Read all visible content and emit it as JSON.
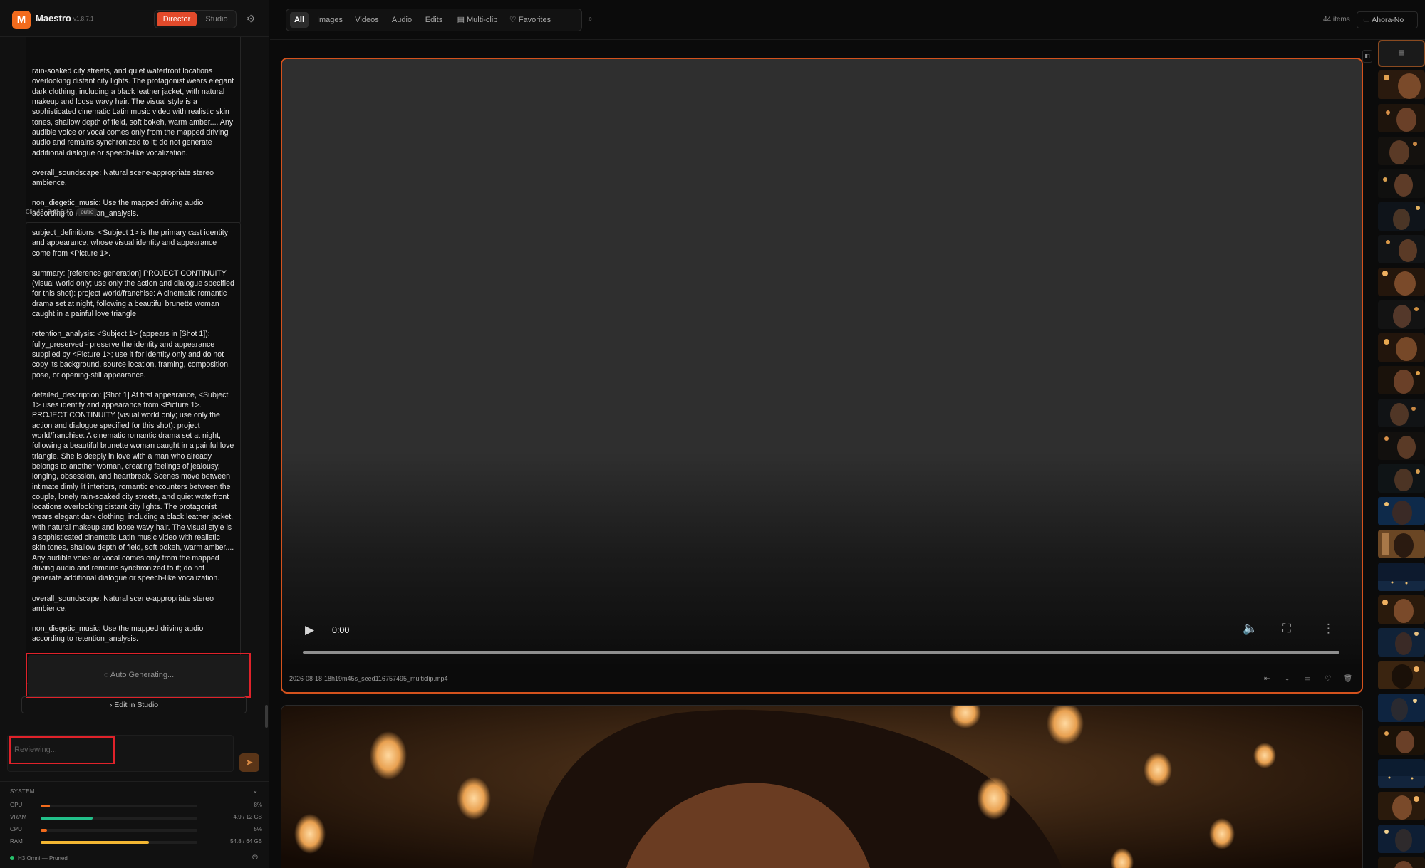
{
  "app": {
    "logo_letter": "M",
    "name": "Maestro",
    "version": "v1.8.7.1",
    "modes": {
      "director": "Director",
      "studio": "Studio"
    },
    "active_mode": "Director"
  },
  "clips": {
    "previous_tail": [
      "rain-soaked city streets, and quiet waterfront locations overlooking distant city lights. The protagonist wears elegant dark clothing, including a black leather jacket, with natural makeup and loose wavy hair. The visual style is a sophisticated cinematic Latin music video with realistic skin tones, shallow depth of field, soft bokeh, warm amber.... Any audible voice or vocal comes only from the mapped driving audio and remains synchronized to it; do not generate additional dialogue or speech-like vocalization.",
      "overall_soundscape: Natural scene-appropriate stereo ambience.",
      "non_diegetic_music: Use the mapped driving audio according to retention_analysis."
    ],
    "clip_43": {
      "label": "Clip 43",
      "time": "3:41-3:47",
      "tag": "outro",
      "paragraphs": [
        "subject_definitions: <Subject 1> is the primary cast identity and appearance, whose visual identity and appearance come from <Picture 1>.",
        "summary: [reference generation] PROJECT CONTINUITY (visual world only; use only the action and dialogue specified for this shot): project world/franchise: A cinematic romantic drama set at night, following a beautiful brunette woman caught in a painful love triangle",
        "retention_analysis: <Subject 1> (appears in [Shot 1]): fully_preserved - preserve the identity and appearance supplied by <Picture 1>; use it for identity only and do not copy its background, source location, framing, composition, pose, or opening-still appearance.",
        "detailed_description: [Shot 1] At first appearance, <Subject 1> uses identity and appearance from <Picture 1>. PROJECT CONTINUITY (visual world only; use only the action and dialogue specified for this shot): project world/franchise: A cinematic romantic drama set at night, following a beautiful brunette woman caught in a painful love triangle. She is deeply in love with a man who already belongs to another woman, creating feelings of jealousy, longing, obsession, and heartbreak. Scenes move between intimate dimly lit interiors, romantic encounters between the couple, lonely rain-soaked city streets, and quiet waterfront locations overlooking distant city lights. The protagonist wears elegant dark clothing, including a black leather jacket, with natural makeup and loose wavy hair. The visual style is a sophisticated cinematic Latin music video with realistic skin tones, shallow depth of field, soft bokeh, warm amber.... Any audible voice or vocal comes only from the mapped driving audio and remains synchronized to it; do not generate additional dialogue or speech-like vocalization.",
        "overall_soundscape: Natural scene-appropriate stereo ambience.",
        "non_diegetic_music: Use the mapped driving audio according to retention_analysis."
      ]
    }
  },
  "actions": {
    "auto_generating": "Auto Generating...",
    "edit_in_studio": "Edit in Studio"
  },
  "review": {
    "placeholder": "Reviewing..."
  },
  "system": {
    "title": "SYSTEM",
    "metrics": [
      {
        "label": "GPU",
        "value": "8%",
        "level": 0.06,
        "color": "#f26b1d"
      },
      {
        "label": "VRAM",
        "value": "4.9 / 12 GB",
        "level": 0.33,
        "color": "#22c08a"
      },
      {
        "label": "CPU",
        "value": "5%",
        "level": 0.04,
        "color": "#f26b1d"
      },
      {
        "label": "RAM",
        "value": "54.8 / 64 GB",
        "level": 0.69,
        "color": "#f2b632"
      }
    ],
    "status": "H3 Omni — Pruned"
  },
  "toolbar": {
    "tabs": [
      "All",
      "Images",
      "Videos",
      "Audio",
      "Edits",
      "Multi-clip",
      "Favorites"
    ],
    "active_tab": "All",
    "item_count": "44 items",
    "project": "Ahora-No"
  },
  "viewer": {
    "time": "0:00",
    "filename": "2026-08-18-18h19m45s_seed116757495_multiclip.mp4"
  },
  "icons": {
    "settings": "gear-icon",
    "search": "search-icon",
    "folder": "folder-icon",
    "play": "play-icon",
    "volume": "volume-icon",
    "fullscreen": "fullscreen-icon",
    "more": "more-vertical-icon",
    "send": "send-icon",
    "power": "power-icon"
  },
  "colors": {
    "accent": "#f26b1d",
    "director_active": "#e24a2b",
    "highlight_box": "#e0222a",
    "selected_border": "#d4521d"
  }
}
